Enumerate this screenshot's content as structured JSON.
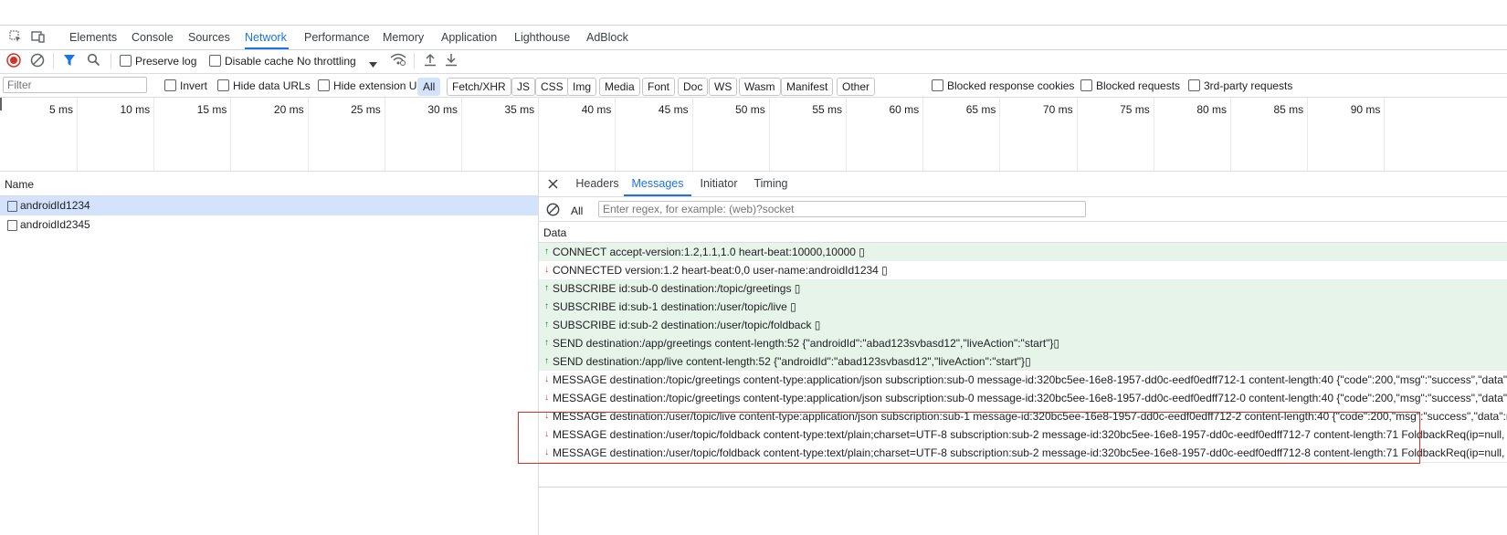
{
  "tabs": [
    "Elements",
    "Console",
    "Sources",
    "Network",
    "Performance",
    "Memory",
    "Application",
    "Lighthouse",
    "AdBlock"
  ],
  "active_tab": "Network",
  "toolbar": {
    "preserve_log": "Preserve log",
    "disable_cache": "Disable cache",
    "throttling": "No throttling"
  },
  "filter": {
    "placeholder": "Filter",
    "invert": "Invert",
    "hide_data_urls": "Hide data URLs",
    "hide_extension_urls": "Hide extension URLs",
    "types": [
      "All",
      "Fetch/XHR",
      "JS",
      "CSS",
      "Img",
      "Media",
      "Font",
      "Doc",
      "WS",
      "Wasm",
      "Manifest",
      "Other"
    ],
    "blocked_response_cookies": "Blocked response cookies",
    "blocked_requests": "Blocked requests",
    "third_party": "3rd-party requests"
  },
  "timeline": {
    "ticks": [
      "5 ms",
      "10 ms",
      "15 ms",
      "20 ms",
      "25 ms",
      "30 ms",
      "35 ms",
      "40 ms",
      "45 ms",
      "50 ms",
      "55 ms",
      "60 ms",
      "65 ms",
      "70 ms",
      "75 ms",
      "80 ms",
      "85 ms",
      "90 ms"
    ]
  },
  "requests": {
    "header": "Name",
    "items": [
      "androidId1234",
      "androidId2345"
    ]
  },
  "detail": {
    "tabs": [
      "Headers",
      "Messages",
      "Initiator",
      "Timing"
    ],
    "active_tab": "Messages",
    "filter_select": "All",
    "regex_placeholder": "Enter regex, for example: (web)?socket",
    "data_header": "Data",
    "messages": [
      {
        "dir": "sent",
        "text": "CONNECT accept-version:1.2,1.1,1.0 heart-beat:10000,10000 ▯"
      },
      {
        "dir": "recv",
        "text": "CONNECTED version:1.2 heart-beat:0,0 user-name:androidId1234 ▯"
      },
      {
        "dir": "sent",
        "text": "SUBSCRIBE id:sub-0 destination:/topic/greetings ▯"
      },
      {
        "dir": "sent",
        "text": "SUBSCRIBE id:sub-1 destination:/user/topic/live ▯"
      },
      {
        "dir": "sent",
        "text": "SUBSCRIBE id:sub-2 destination:/user/topic/foldback ▯"
      },
      {
        "dir": "sent",
        "text": "SEND destination:/app/greetings content-length:52 {\"androidId\":\"abad123svbasd12\",\"liveAction\":\"start\"}▯"
      },
      {
        "dir": "sent",
        "text": "SEND destination:/app/live content-length:52 {\"androidId\":\"abad123svbasd12\",\"liveAction\":\"start\"}▯"
      },
      {
        "dir": "recv",
        "text": "MESSAGE destination:/topic/greetings content-type:application/json subscription:sub-0 message-id:320bc5ee-16e8-1957-dd0c-eedf0edff712-1 content-length:40 {\"code\":200,\"msg\":\"success\",\"data\":"
      },
      {
        "dir": "recv",
        "text": "MESSAGE destination:/topic/greetings content-type:application/json subscription:sub-0 message-id:320bc5ee-16e8-1957-dd0c-eedf0edff712-0 content-length:40 {\"code\":200,\"msg\":\"success\",\"data\":"
      },
      {
        "dir": "recv",
        "text": "MESSAGE destination:/user/topic/live content-type:application/json subscription:sub-1 message-id:320bc5ee-16e8-1957-dd0c-eedf0edff712-2 content-length:40 {\"code\":200,\"msg\":\"success\",\"data\":n"
      },
      {
        "dir": "recv",
        "text": "MESSAGE destination:/user/topic/foldback content-type:text/plain;charset=UTF-8 subscription:sub-2 message-id:320bc5ee-16e8-1957-dd0c-eedf0edff712-7 content-length:71 FoldbackReq(ip=null, i"
      },
      {
        "dir": "recv",
        "text": "MESSAGE destination:/user/topic/foldback content-type:text/plain;charset=UTF-8 subscription:sub-2 message-id:320bc5ee-16e8-1957-dd0c-eedf0edff712-8 content-length:71 FoldbackReq(ip=null, i"
      }
    ]
  },
  "colors": {
    "accent": "#1a73e8",
    "sent_bg": "#e6f4ea",
    "highlight_border": "#d93025",
    "record": "#d93025"
  }
}
